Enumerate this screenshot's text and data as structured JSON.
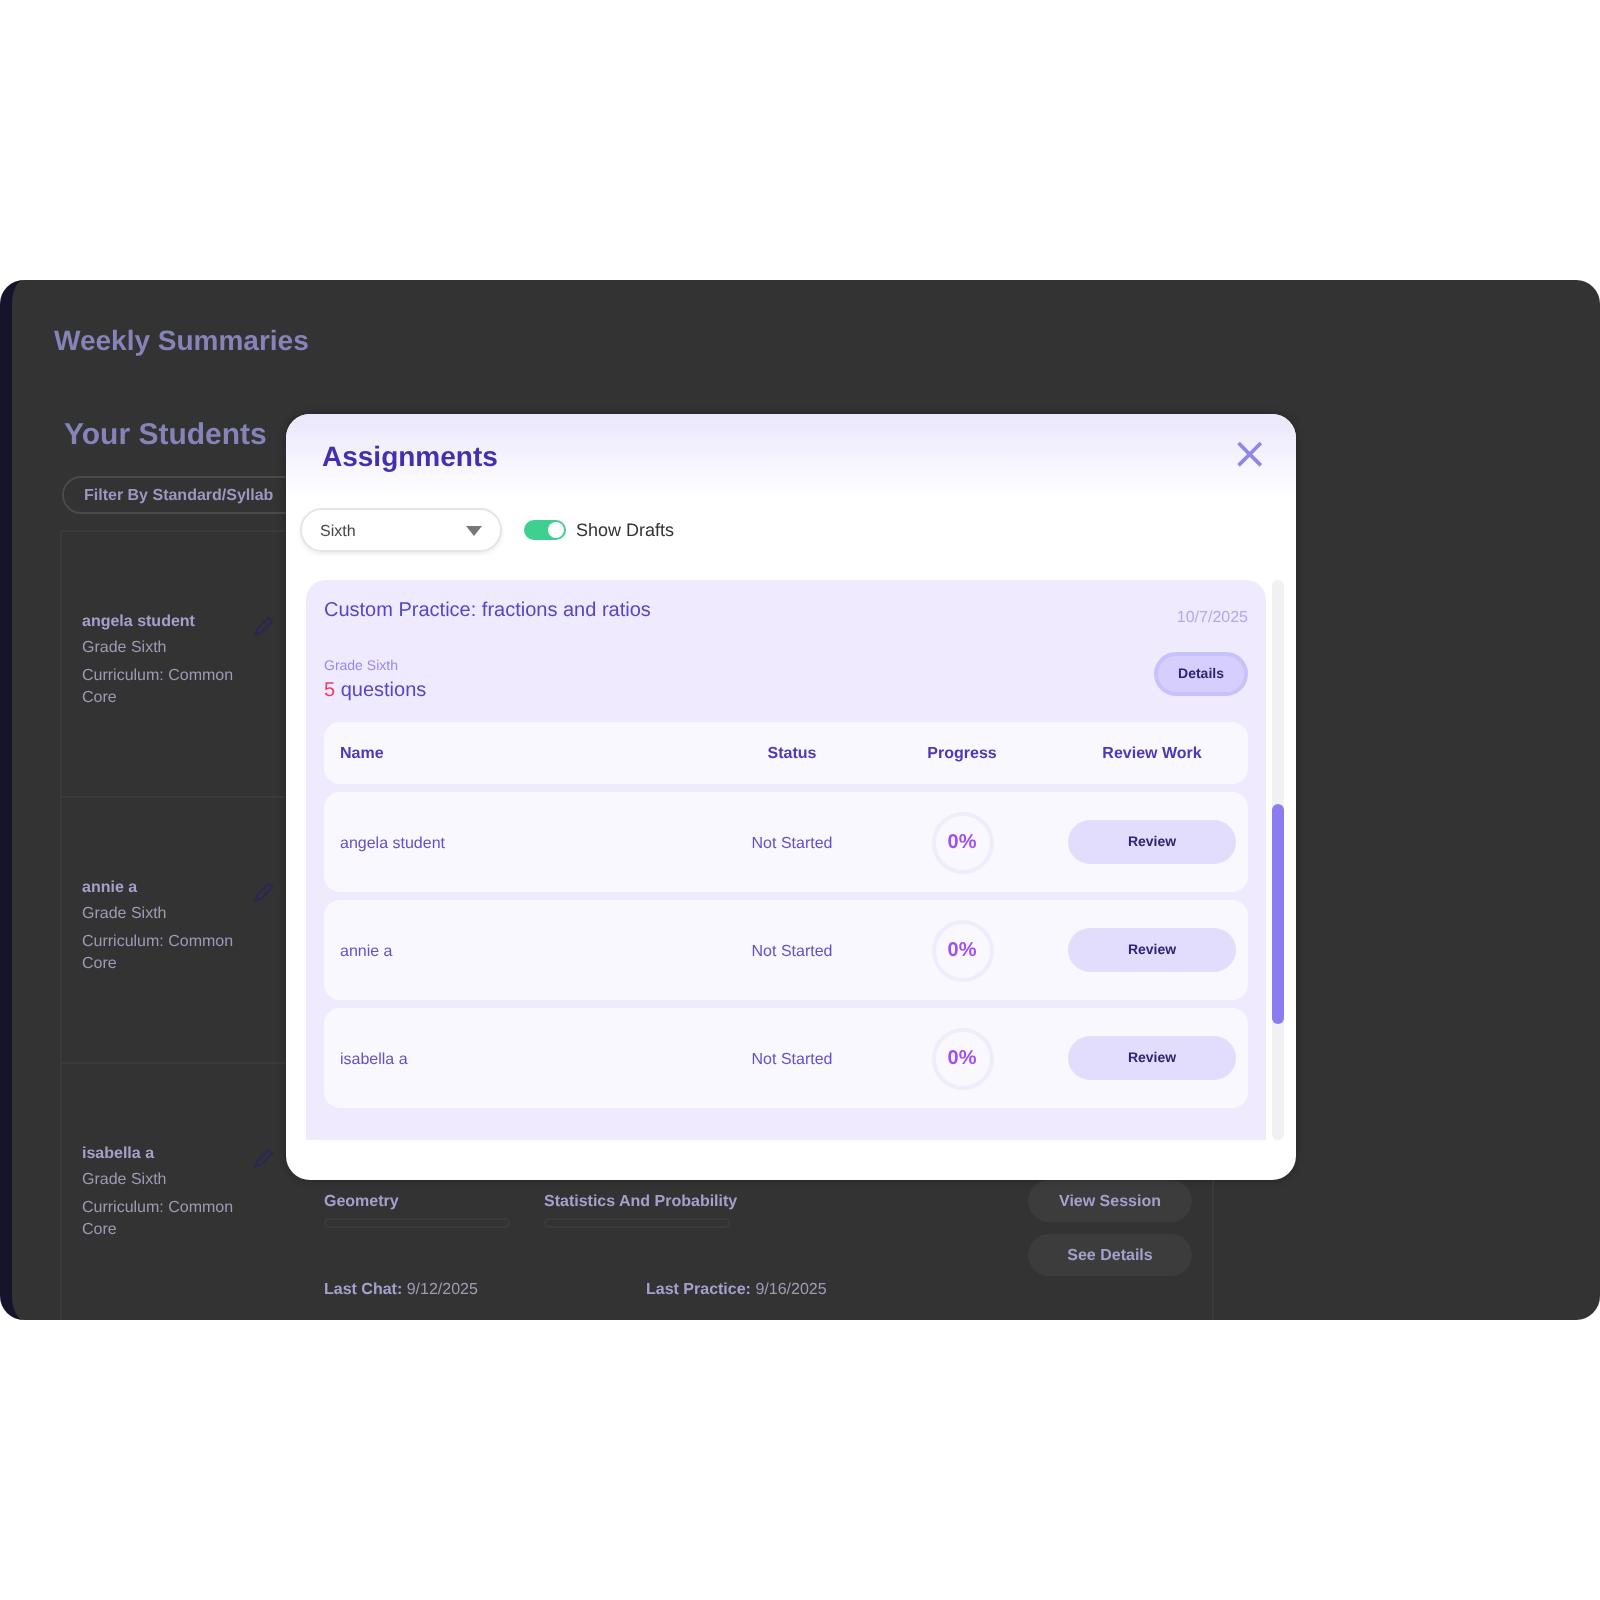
{
  "page": {
    "title": "Weekly Summaries",
    "section_title": "Your Students",
    "filter": {
      "placeholder": "Filter By Standard/Syllab"
    },
    "students": [
      {
        "name": "angela student",
        "grade": "Grade Sixth",
        "curriculum": "Curriculum: Common Core"
      },
      {
        "name": "annie a",
        "grade": "Grade Sixth",
        "curriculum": "Curriculum: Common Core"
      },
      {
        "name": "isabella a",
        "grade": "Grade Sixth",
        "curriculum": "Curriculum: Common Core"
      }
    ],
    "subjects": [
      "Geometry",
      "Statistics And Probability"
    ],
    "last_chat": {
      "label": "Last Chat:",
      "value": "9/12/2025"
    },
    "last_practice": {
      "label": "Last Practice:",
      "value": "9/16/2025"
    },
    "actions": [
      "View Session",
      "See Details"
    ]
  },
  "modal": {
    "title": "Assignments",
    "close": "×",
    "grade_select": {
      "value": "Sixth"
    },
    "show_drafts": {
      "label": "Show Drafts",
      "on": true
    },
    "assignment": {
      "title": "Custom Practice: fractions and ratios",
      "date": "10/7/2025",
      "grade": "Grade Sixth",
      "question_count": "5",
      "question_label": "questions",
      "details_button": "Details",
      "columns": [
        "Name",
        "Status",
        "Progress",
        "Review Work"
      ],
      "rows": [
        {
          "name": "angela student",
          "status": "Not Started",
          "progress": "0%",
          "action": "Review"
        },
        {
          "name": "annie a",
          "status": "Not Started",
          "progress": "0%",
          "action": "Review"
        },
        {
          "name": "isabella a",
          "status": "Not Started",
          "progress": "0%",
          "action": "Review"
        }
      ]
    }
  }
}
